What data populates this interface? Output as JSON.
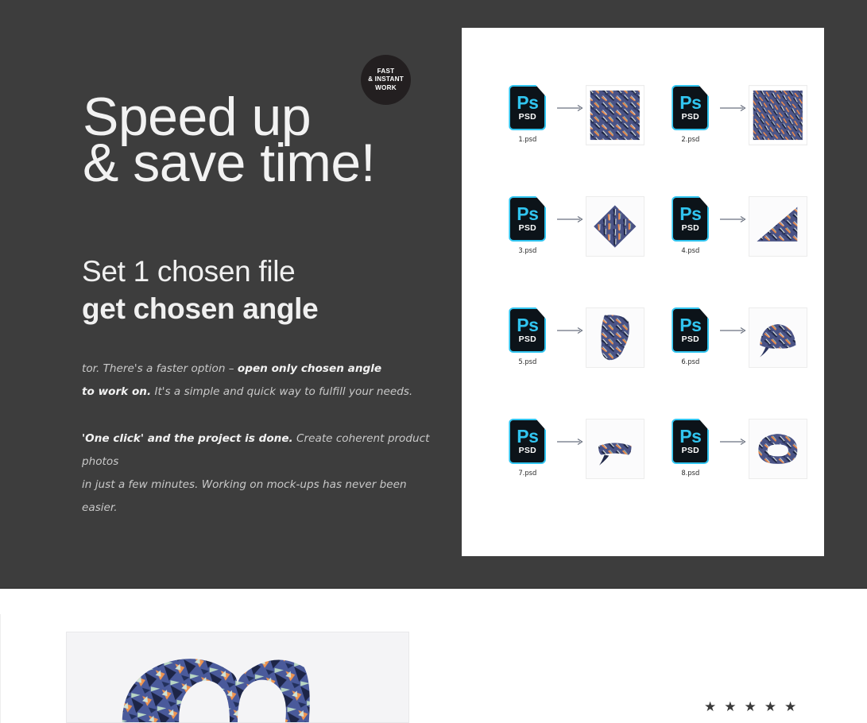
{
  "hero": {
    "background_color": "#3d3d3d",
    "badge": {
      "line1": "FAST",
      "line2": "& INSTANT",
      "line3": "WORK",
      "background_color": "#231f20",
      "text_color": "#ffffff"
    },
    "headline": {
      "line1": "Speed up",
      "line2": "& save time!",
      "color": "#f2f2f2"
    },
    "subheadline": {
      "line1": "Set 1 chosen file",
      "line2": "get chosen angle",
      "color": "#f0f0f0"
    },
    "paragraph1": {
      "part1": "tor. There's a faster option – ",
      "bold1": "open only chosen angle",
      "bold2": "to work on.",
      "part2": " It's a simple and quick way to fulfill your needs."
    },
    "paragraph2": {
      "bold1": "'One click' and the project is done.",
      "part1": "  Create coherent product photos",
      "part2": "in just a few minutes. Working on mock-ups has never been easier."
    }
  },
  "panel": {
    "background_color": "#ffffff",
    "accent_color": "#31c5f0",
    "icon_body_color": "#0c1319",
    "arrow_icon": "arrow-right-icon",
    "items": [
      {
        "file": "1.psd",
        "icon": "psd-file-icon",
        "thumb_name": "scarf-flat-pattern-thumb"
      },
      {
        "file": "2.psd",
        "icon": "psd-file-icon",
        "thumb_name": "scarf-flat-pattern-alt-thumb"
      },
      {
        "file": "3.psd",
        "icon": "psd-file-icon",
        "thumb_name": "scarf-diamond-fold-thumb"
      },
      {
        "file": "4.psd",
        "icon": "psd-file-icon",
        "thumb_name": "scarf-triangle-fold-thumb"
      },
      {
        "file": "5.psd",
        "icon": "psd-file-icon",
        "thumb_name": "scarf-draped-thumb"
      },
      {
        "file": "6.psd",
        "icon": "psd-file-icon",
        "thumb_name": "scarf-headwrap-thumb"
      },
      {
        "file": "7.psd",
        "icon": "psd-file-icon",
        "thumb_name": "scarf-headband-flat-thumb"
      },
      {
        "file": "8.psd",
        "icon": "psd-file-icon",
        "thumb_name": "scarf-headband-ring-thumb"
      }
    ]
  },
  "bottom": {
    "product_photo_name": "scarf-headband-product-photo",
    "rating": {
      "stars": [
        "★",
        "★",
        "★",
        "★",
        "★"
      ],
      "color": "#3a3a3a"
    }
  }
}
